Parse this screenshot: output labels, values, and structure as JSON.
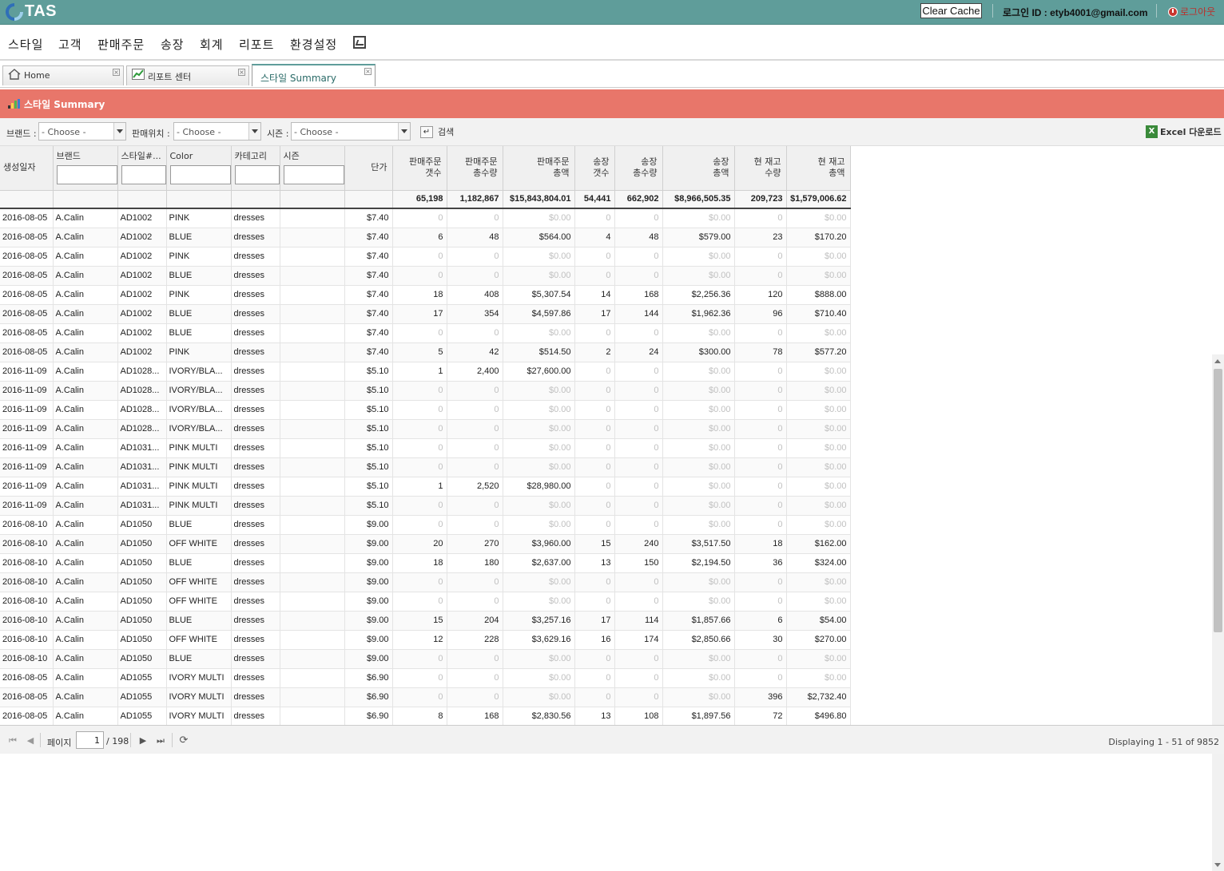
{
  "app": {
    "logo_text": "TAS"
  },
  "topbar": {
    "clear_cache_label": "Clear Cache",
    "login_text": "로그인 ID : etyb4001@gmail.com",
    "logout_label": "로그아웃"
  },
  "menu": {
    "items": [
      "스타일",
      "고객",
      "판매주문",
      "송장",
      "회계",
      "리포트",
      "환경설정"
    ],
    "extra_icon": "monitor-chart-icon"
  },
  "tabs": [
    {
      "label": "Home",
      "icon": "home-icon"
    },
    {
      "label": "리포트 센터",
      "icon": "chart-icon"
    },
    {
      "label": "스타일 Summary",
      "icon": ""
    }
  ],
  "page": {
    "title": "스타일 Summary",
    "title_icon": "bar-chart-icon"
  },
  "filters": {
    "brand_label": "브랜드 :",
    "brand_value": "- Choose -",
    "location_label": "판매위치 :",
    "location_value": "- Choose -",
    "season_label": "시즌 :",
    "season_value": "- Choose -",
    "search_label": "검색",
    "excel_label": "Excel 다운로드"
  },
  "colors": {
    "topbar": "#5f9d9a",
    "title": "#e8766a"
  },
  "columns": [
    {
      "key": "date",
      "label": "생성일자"
    },
    {
      "key": "brand",
      "label": "브랜드",
      "filter": true
    },
    {
      "key": "style",
      "label": "스타일#...",
      "filter": true
    },
    {
      "key": "color",
      "label": "Color",
      "filter": true
    },
    {
      "key": "cat",
      "label": "카테고리",
      "filter": true
    },
    {
      "key": "season",
      "label": "시즌",
      "filter": true
    },
    {
      "key": "price",
      "label": "단가"
    },
    {
      "key": "so_cnt",
      "label": "판매주문\n갯수"
    },
    {
      "key": "so_qty",
      "label": "판매주문\n총수량"
    },
    {
      "key": "so_amt",
      "label": "판매주문\n총액"
    },
    {
      "key": "iv_cnt",
      "label": "송장\n갯수"
    },
    {
      "key": "iv_qty",
      "label": "송장\n총수량"
    },
    {
      "key": "iv_amt",
      "label": "송장\n총액"
    },
    {
      "key": "st_qty",
      "label": "현 재고\n수량"
    },
    {
      "key": "st_amt",
      "label": "현 재고\n총액"
    }
  ],
  "totals": {
    "so_cnt": "65,198",
    "so_qty": "1,182,867",
    "so_amt": "$15,843,804.01",
    "iv_cnt": "54,441",
    "iv_qty": "662,902",
    "iv_amt": "$8,966,505.35",
    "st_qty": "209,723",
    "st_amt": "$1,579,006.62"
  },
  "rows": [
    [
      "2016-08-05",
      "A.Calin",
      "AD1002",
      "PINK",
      "dresses",
      "",
      "$7.40",
      "0",
      "0",
      "$0.00",
      "0",
      "0",
      "$0.00",
      "0",
      "$0.00"
    ],
    [
      "2016-08-05",
      "A.Calin",
      "AD1002",
      "BLUE",
      "dresses",
      "",
      "$7.40",
      "6",
      "48",
      "$564.00",
      "4",
      "48",
      "$579.00",
      "23",
      "$170.20"
    ],
    [
      "2016-08-05",
      "A.Calin",
      "AD1002",
      "PINK",
      "dresses",
      "",
      "$7.40",
      "0",
      "0",
      "$0.00",
      "0",
      "0",
      "$0.00",
      "0",
      "$0.00"
    ],
    [
      "2016-08-05",
      "A.Calin",
      "AD1002",
      "BLUE",
      "dresses",
      "",
      "$7.40",
      "0",
      "0",
      "$0.00",
      "0",
      "0",
      "$0.00",
      "0",
      "$0.00"
    ],
    [
      "2016-08-05",
      "A.Calin",
      "AD1002",
      "PINK",
      "dresses",
      "",
      "$7.40",
      "18",
      "408",
      "$5,307.54",
      "14",
      "168",
      "$2,256.36",
      "120",
      "$888.00"
    ],
    [
      "2016-08-05",
      "A.Calin",
      "AD1002",
      "BLUE",
      "dresses",
      "",
      "$7.40",
      "17",
      "354",
      "$4,597.86",
      "17",
      "144",
      "$1,962.36",
      "96",
      "$710.40"
    ],
    [
      "2016-08-05",
      "A.Calin",
      "AD1002",
      "BLUE",
      "dresses",
      "",
      "$7.40",
      "0",
      "0",
      "$0.00",
      "0",
      "0",
      "$0.00",
      "0",
      "$0.00"
    ],
    [
      "2016-08-05",
      "A.Calin",
      "AD1002",
      "PINK",
      "dresses",
      "",
      "$7.40",
      "5",
      "42",
      "$514.50",
      "2",
      "24",
      "$300.00",
      "78",
      "$577.20"
    ],
    [
      "2016-11-09",
      "A.Calin",
      "AD1028...",
      "IVORY/BLA...",
      "dresses",
      "",
      "$5.10",
      "1",
      "2,400",
      "$27,600.00",
      "0",
      "0",
      "$0.00",
      "0",
      "$0.00"
    ],
    [
      "2016-11-09",
      "A.Calin",
      "AD1028...",
      "IVORY/BLA...",
      "dresses",
      "",
      "$5.10",
      "0",
      "0",
      "$0.00",
      "0",
      "0",
      "$0.00",
      "0",
      "$0.00"
    ],
    [
      "2016-11-09",
      "A.Calin",
      "AD1028...",
      "IVORY/BLA...",
      "dresses",
      "",
      "$5.10",
      "0",
      "0",
      "$0.00",
      "0",
      "0",
      "$0.00",
      "0",
      "$0.00"
    ],
    [
      "2016-11-09",
      "A.Calin",
      "AD1028...",
      "IVORY/BLA...",
      "dresses",
      "",
      "$5.10",
      "0",
      "0",
      "$0.00",
      "0",
      "0",
      "$0.00",
      "0",
      "$0.00"
    ],
    [
      "2016-11-09",
      "A.Calin",
      "AD1031...",
      "PINK MULTI",
      "dresses",
      "",
      "$5.10",
      "0",
      "0",
      "$0.00",
      "0",
      "0",
      "$0.00",
      "0",
      "$0.00"
    ],
    [
      "2016-11-09",
      "A.Calin",
      "AD1031...",
      "PINK MULTI",
      "dresses",
      "",
      "$5.10",
      "0",
      "0",
      "$0.00",
      "0",
      "0",
      "$0.00",
      "0",
      "$0.00"
    ],
    [
      "2016-11-09",
      "A.Calin",
      "AD1031...",
      "PINK MULTI",
      "dresses",
      "",
      "$5.10",
      "1",
      "2,520",
      "$28,980.00",
      "0",
      "0",
      "$0.00",
      "0",
      "$0.00"
    ],
    [
      "2016-11-09",
      "A.Calin",
      "AD1031...",
      "PINK MULTI",
      "dresses",
      "",
      "$5.10",
      "0",
      "0",
      "$0.00",
      "0",
      "0",
      "$0.00",
      "0",
      "$0.00"
    ],
    [
      "2016-08-10",
      "A.Calin",
      "AD1050",
      "BLUE",
      "dresses",
      "",
      "$9.00",
      "0",
      "0",
      "$0.00",
      "0",
      "0",
      "$0.00",
      "0",
      "$0.00"
    ],
    [
      "2016-08-10",
      "A.Calin",
      "AD1050",
      "OFF WHITE",
      "dresses",
      "",
      "$9.00",
      "20",
      "270",
      "$3,960.00",
      "15",
      "240",
      "$3,517.50",
      "18",
      "$162.00"
    ],
    [
      "2016-08-10",
      "A.Calin",
      "AD1050",
      "BLUE",
      "dresses",
      "",
      "$9.00",
      "18",
      "180",
      "$2,637.00",
      "13",
      "150",
      "$2,194.50",
      "36",
      "$324.00"
    ],
    [
      "2016-08-10",
      "A.Calin",
      "AD1050",
      "OFF WHITE",
      "dresses",
      "",
      "$9.00",
      "0",
      "0",
      "$0.00",
      "0",
      "0",
      "$0.00",
      "0",
      "$0.00"
    ],
    [
      "2016-08-10",
      "A.Calin",
      "AD1050",
      "OFF WHITE",
      "dresses",
      "",
      "$9.00",
      "0",
      "0",
      "$0.00",
      "0",
      "0",
      "$0.00",
      "0",
      "$0.00"
    ],
    [
      "2016-08-10",
      "A.Calin",
      "AD1050",
      "BLUE",
      "dresses",
      "",
      "$9.00",
      "15",
      "204",
      "$3,257.16",
      "17",
      "114",
      "$1,857.66",
      "6",
      "$54.00"
    ],
    [
      "2016-08-10",
      "A.Calin",
      "AD1050",
      "OFF WHITE",
      "dresses",
      "",
      "$9.00",
      "12",
      "228",
      "$3,629.16",
      "16",
      "174",
      "$2,850.66",
      "30",
      "$270.00"
    ],
    [
      "2016-08-10",
      "A.Calin",
      "AD1050",
      "BLUE",
      "dresses",
      "",
      "$9.00",
      "0",
      "0",
      "$0.00",
      "0",
      "0",
      "$0.00",
      "0",
      "$0.00"
    ],
    [
      "2016-08-05",
      "A.Calin",
      "AD1055",
      "IVORY MULTI",
      "dresses",
      "",
      "$6.90",
      "0",
      "0",
      "$0.00",
      "0",
      "0",
      "$0.00",
      "0",
      "$0.00"
    ],
    [
      "2016-08-05",
      "A.Calin",
      "AD1055",
      "IVORY MULTI",
      "dresses",
      "",
      "$6.90",
      "0",
      "0",
      "$0.00",
      "0",
      "0",
      "$0.00",
      "396",
      "$2,732.40"
    ],
    [
      "2016-08-05",
      "A.Calin",
      "AD1055",
      "IVORY MULTI",
      "dresses",
      "",
      "$6.90",
      "8",
      "168",
      "$2,830.56",
      "13",
      "108",
      "$1,897.56",
      "72",
      "$496.80"
    ]
  ],
  "pager": {
    "page_label": "페이지",
    "page_value": "1",
    "of_pages": "/ 198",
    "display_text": "Displaying 1 - 51 of 9852"
  }
}
